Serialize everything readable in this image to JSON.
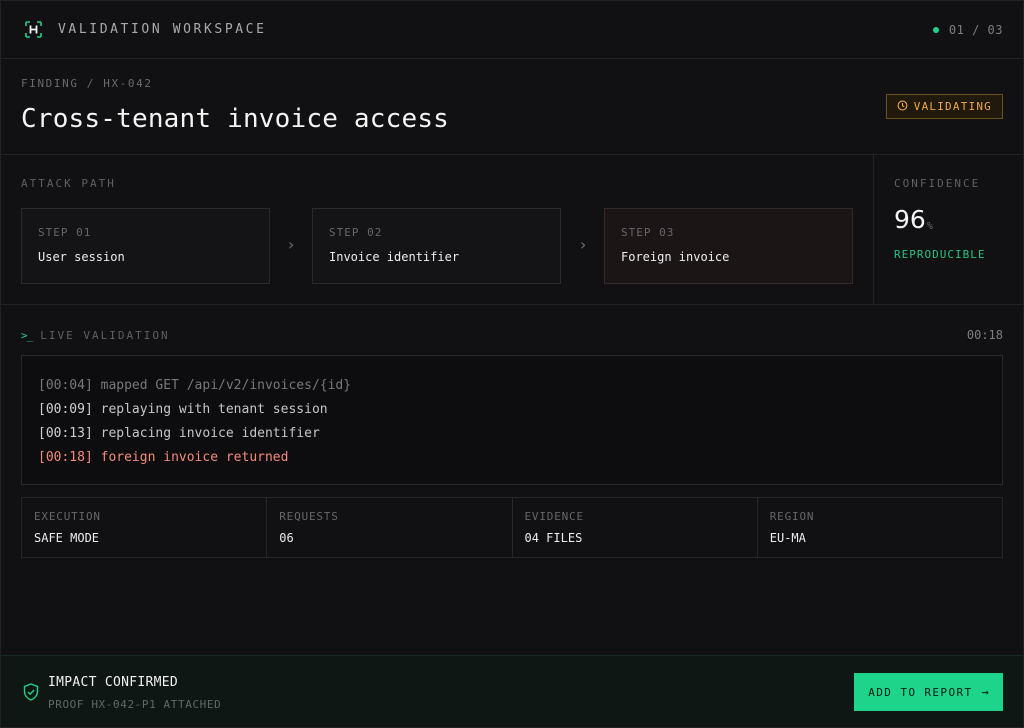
{
  "header": {
    "app_title": "VALIDATION WORKSPACE",
    "pager": "01 / 03",
    "logo_icon": "h-logo-icon",
    "status_color": "#1ed38a"
  },
  "finding": {
    "breadcrumb": "FINDING / HX-042",
    "title": "Cross-tenant invoice access",
    "status": "VALIDATING",
    "status_icon": "clock-icon"
  },
  "attack_path": {
    "label": "ATTACK PATH",
    "steps": [
      {
        "num": "STEP 01",
        "label": "User session"
      },
      {
        "num": "STEP 02",
        "label": "Invoice identifier"
      },
      {
        "num": "STEP 03",
        "label": "Foreign invoice"
      }
    ]
  },
  "confidence": {
    "label": "CONFIDENCE",
    "value": "96",
    "unit": "%",
    "state": "REPRODUCIBLE"
  },
  "live": {
    "label": "LIVE VALIDATION",
    "elapsed": "00:18",
    "log": [
      {
        "ts": "[00:04]",
        "msg": " mapped GET /api/v2/invoices/{id}"
      },
      {
        "ts": "[00:09]",
        "msg": " replaying with tenant session"
      },
      {
        "ts": "[00:13]",
        "msg": " replacing invoice identifier"
      },
      {
        "ts": "[00:18]",
        "msg": " foreign invoice returned"
      }
    ]
  },
  "meta": [
    {
      "key": "EXECUTION",
      "value": "SAFE MODE"
    },
    {
      "key": "REQUESTS",
      "value": "06"
    },
    {
      "key": "EVIDENCE",
      "value": "04 FILES"
    },
    {
      "key": "REGION",
      "value": "EU-MA"
    }
  ],
  "footer": {
    "title": "IMPACT CONFIRMED",
    "subtitle": "PROOF HX-042-P1 ATTACHED",
    "button": "ADD TO REPORT",
    "accent": "#1ed38a"
  }
}
